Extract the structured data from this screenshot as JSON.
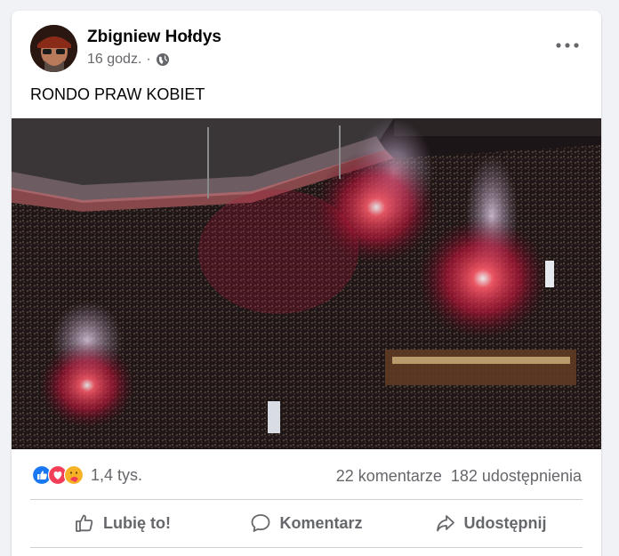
{
  "post": {
    "author": "Zbigniew Hołdys",
    "time": "16 godz.",
    "separator": "·",
    "text": "RONDO PRAW KOBIET"
  },
  "stats": {
    "reactions_count": "1,4 tys.",
    "comments": "22 komentarze",
    "shares": "182 udostępnienia"
  },
  "actions": {
    "like": "Lubię to!",
    "comment": "Komentarz",
    "share": "Udostępnij"
  },
  "icons": {
    "privacy": "globe-icon",
    "menu": "more-options-icon",
    "reactions": [
      "like-reaction-icon",
      "love-reaction-icon",
      "care-reaction-icon"
    ]
  },
  "colors": {
    "like_blue": "#1877f2",
    "love_red": "#f33e58",
    "care_yellow": "#f7b125",
    "secondary_text": "#65676b"
  }
}
